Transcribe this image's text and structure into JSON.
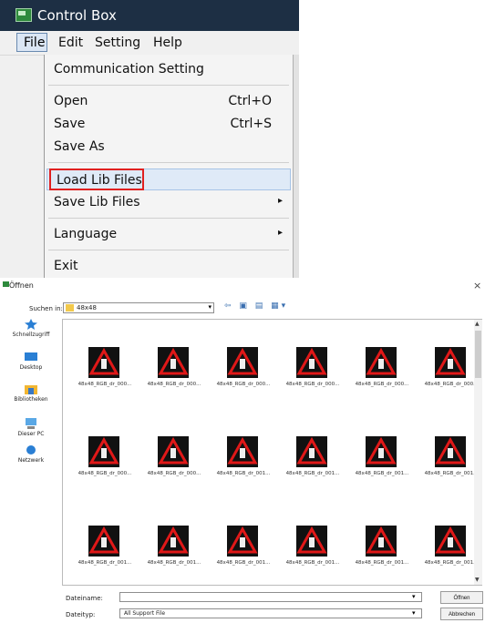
{
  "control_box": {
    "title": "Control Box",
    "menubar": [
      "File",
      "Edit",
      "Setting",
      "Help"
    ],
    "file_menu": {
      "communication": "Communication Setting",
      "open": "Open",
      "open_shortcut": "Ctrl+O",
      "save": "Save",
      "save_shortcut": "Ctrl+S",
      "save_as": "Save As",
      "load_lib": "Load Lib Files",
      "save_lib": "Save Lib Files",
      "language": "Language",
      "exit": "Exit",
      "submenu_arrow": "▸"
    },
    "colors": {
      "titlebar": "#1d2f44",
      "highlight_border": "#e02020"
    }
  },
  "dialog": {
    "title": "Öffnen",
    "close": "×",
    "lookin_label": "Suchen in:",
    "lookin_value": "48x48",
    "places": [
      "Schnellzugriff",
      "Desktop",
      "Bibliotheken",
      "Dieser PC",
      "Netzwerk"
    ],
    "files": [
      "48x48_RGB_dr_000...",
      "48x48_RGB_dr_000...",
      "48x48_RGB_dr_000...",
      "48x48_RGB_dr_000...",
      "48x48_RGB_dr_000...",
      "48x48_RGB_dr_000...",
      "48x48_RGB_dr_000...",
      "48x48_RGB_dr_000...",
      "48x48_RGB_dr_001...",
      "48x48_RGB_dr_001...",
      "48x48_RGB_dr_001...",
      "48x48_RGB_dr_001...",
      "48x48_RGB_dr_001...",
      "48x48_RGB_dr_001...",
      "48x48_RGB_dr_001...",
      "48x48_RGB_dr_001...",
      "48x48_RGB_dr_001...",
      "48x48_RGB_dr_001..."
    ],
    "filename_label": "Dateiname:",
    "filetype_label": "Dateityp:",
    "filetype_value": "All Support File",
    "open_button": "Öffnen",
    "cancel_button": "Abbrechen",
    "icons": [
      "warning-sign-icon"
    ]
  }
}
